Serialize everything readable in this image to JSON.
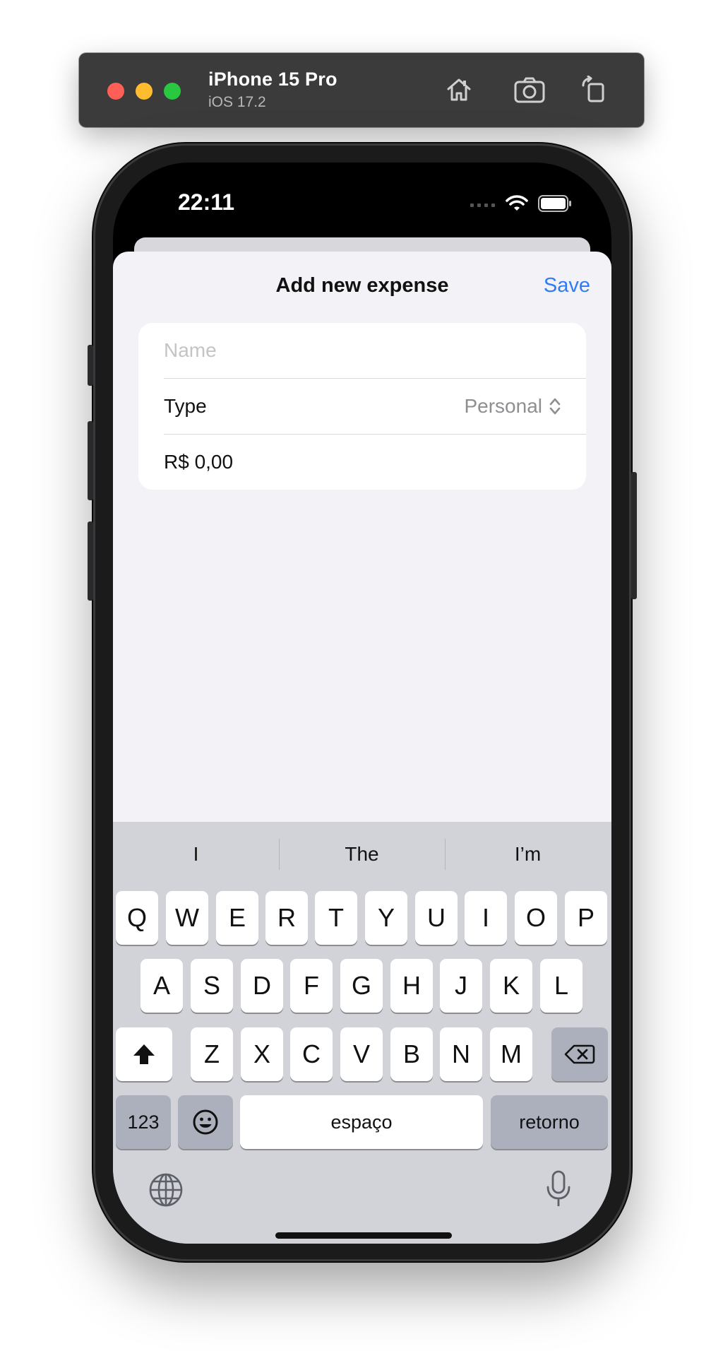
{
  "simulator": {
    "device_name": "iPhone 15 Pro",
    "os_version": "iOS 17.2",
    "toolbar_icons": [
      "home-icon",
      "screenshot-icon",
      "rotate-icon"
    ]
  },
  "status_bar": {
    "time": "22:11",
    "icons": [
      "cellular-icon",
      "wifi-icon",
      "battery-icon"
    ]
  },
  "sheet": {
    "title": "Add new expense",
    "save_label": "Save"
  },
  "form": {
    "name_placeholder": "Name",
    "name_value": "",
    "type_label": "Type",
    "type_value": "Personal",
    "amount_value": "R$ 0,00"
  },
  "keyboard": {
    "suggestions": [
      "I",
      "The",
      "I’m"
    ],
    "row1": [
      "Q",
      "W",
      "E",
      "R",
      "T",
      "Y",
      "U",
      "I",
      "O",
      "P"
    ],
    "row2": [
      "A",
      "S",
      "D",
      "F",
      "G",
      "H",
      "J",
      "K",
      "L"
    ],
    "row3": [
      "Z",
      "X",
      "C",
      "V",
      "B",
      "N",
      "M"
    ],
    "numbers_label": "123",
    "space_label": "espaço",
    "return_label": "retorno",
    "icons": [
      "shift-icon",
      "backspace-icon",
      "emoji-icon",
      "globe-icon",
      "microphone-icon"
    ]
  },
  "colors": {
    "accent": "#2f7cf6",
    "sheet_background": "#f2f2f7",
    "keyboard_background": "#d1d3d9"
  }
}
